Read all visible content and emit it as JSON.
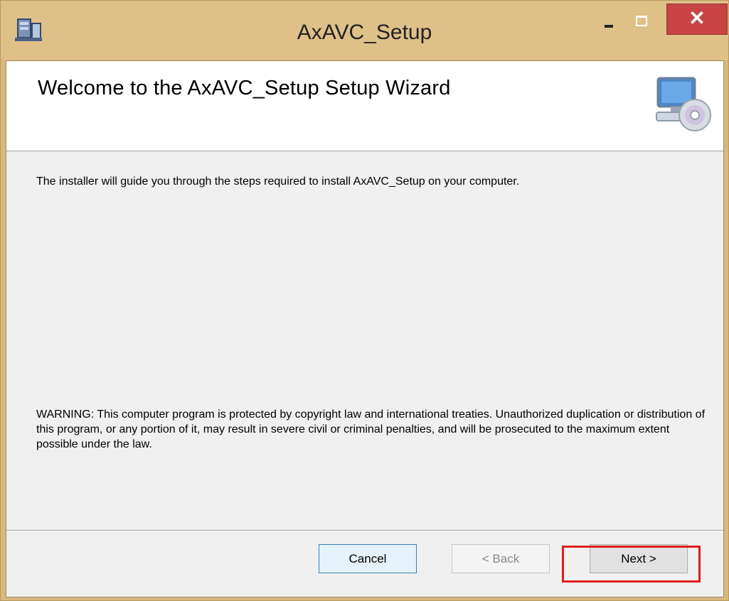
{
  "window": {
    "title": "AxAVC_Setup",
    "controls": {
      "minimize": "minimize-icon",
      "maximize": "maximize-icon",
      "close": "close-icon"
    }
  },
  "banner": {
    "heading": "Welcome to the AxAVC_Setup Setup Wizard",
    "icon": "computer-with-disc-icon"
  },
  "body": {
    "intro": "The installer will guide you through the steps required to install AxAVC_Setup on your computer.",
    "warning": "WARNING: This computer program is protected by copyright law and international treaties. Unauthorized duplication or distribution of this program, or any portion of it, may result in severe civil or criminal penalties, and will be prosecuted to the maximum extent possible under the law."
  },
  "buttons": {
    "cancel": "Cancel",
    "back": "< Back",
    "next": "Next >"
  },
  "colors": {
    "titlebar": "#dfc089",
    "close": "#c84343",
    "highlight": "#e01b1b"
  }
}
